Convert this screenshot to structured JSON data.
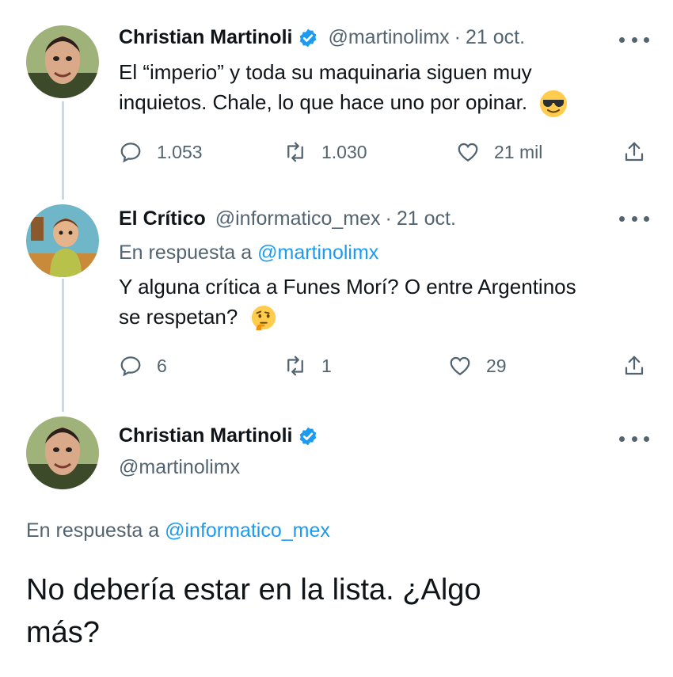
{
  "tweets": [
    {
      "name": "Christian Martinoli",
      "handle": "@martinolimx",
      "separator": "·",
      "date": "21 oct.",
      "text_line1": "El “imperio” y toda su maquinaria siguen muy",
      "text_line2": "inquietos. Chale, lo que hace uno por opinar.",
      "emoji": "sunglasses-face",
      "replies": "1.053",
      "retweets": "1.030",
      "likes": "21 mil"
    },
    {
      "name": "El Crítico",
      "handle": "@informatico_mex",
      "separator": "·",
      "date": "21 oct.",
      "reply_prefix": "En respuesta a",
      "reply_to": "@martinolimx",
      "text_line1": "Y alguna crítica a Funes Morí? O entre Argentinos",
      "text_line2": "se respetan?",
      "emoji": "thinking-face",
      "replies": "6",
      "retweets": "1",
      "likes": "29"
    }
  ],
  "main_tweet": {
    "name": "Christian Martinoli",
    "handle": "@martinolimx",
    "reply_prefix": "En respuesta a",
    "reply_to": "@informatico_mex",
    "text_line1": "No debería estar en la lista. ¿Algo",
    "text_line2": "más?"
  },
  "colors": {
    "accent": "#1d9bf0",
    "secondary_text": "#536471",
    "primary_text": "#0f1419",
    "thread_line": "#cfd9de"
  }
}
